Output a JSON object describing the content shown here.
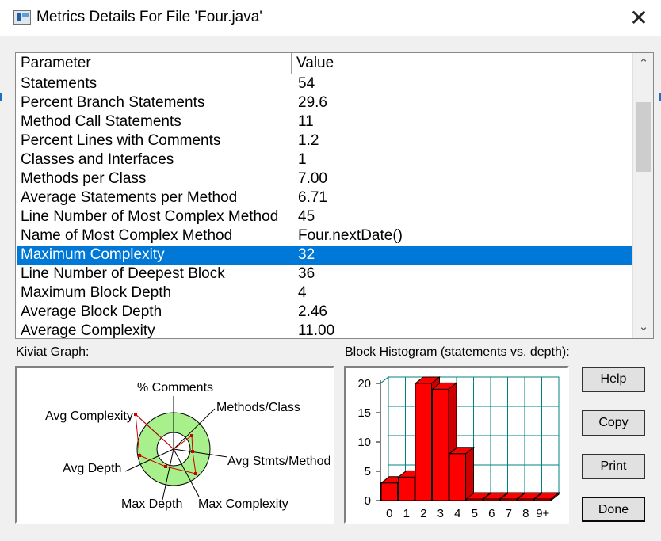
{
  "window": {
    "title": "Metrics Details For File 'Four.java'",
    "close_glyph": "✕"
  },
  "table": {
    "headers": {
      "parameter": "Parameter",
      "value": "Value"
    },
    "rows": [
      {
        "parameter": "Statements",
        "value": "54"
      },
      {
        "parameter": "Percent Branch Statements",
        "value": "29.6"
      },
      {
        "parameter": "Method Call Statements",
        "value": "11"
      },
      {
        "parameter": "Percent Lines with Comments",
        "value": "1.2"
      },
      {
        "parameter": "Classes and Interfaces",
        "value": "1"
      },
      {
        "parameter": "Methods per Class",
        "value": "7.00"
      },
      {
        "parameter": "Average Statements per Method",
        "value": "6.71"
      },
      {
        "parameter": "Line Number of Most Complex Method",
        "value": "45"
      },
      {
        "parameter": "Name of Most Complex Method",
        "value": "Four.nextDate()"
      },
      {
        "parameter": "Maximum Complexity",
        "value": "32",
        "selected": true
      },
      {
        "parameter": "Line Number of Deepest Block",
        "value": "36"
      },
      {
        "parameter": "Maximum Block Depth",
        "value": "4"
      },
      {
        "parameter": "Average Block Depth",
        "value": "2.46"
      },
      {
        "parameter": "Average Complexity",
        "value": "11.00"
      }
    ],
    "scroll_up_glyph": "⌃",
    "scroll_down_glyph": "⌄"
  },
  "kiviat": {
    "label": "Kiviat Graph:",
    "axes": [
      "% Comments",
      "Methods/Class",
      "Avg Stmts/Method",
      "Max Complexity",
      "Max Depth",
      "Avg Depth",
      "Avg Complexity"
    ],
    "ring_color": "#a8f08c",
    "polygon_color": "#cc0000"
  },
  "histogram": {
    "label": "Block Histogram (statements vs. depth):",
    "bar_color": "#ff0000",
    "grid_color": "#008080"
  },
  "chart_data": {
    "type": "bar",
    "title": "Block Histogram (statements vs. depth):",
    "categories": [
      "0",
      "1",
      "2",
      "3",
      "4",
      "5",
      "6",
      "7",
      "8",
      "9+"
    ],
    "values": [
      3,
      4,
      20,
      19,
      8,
      0,
      0,
      0,
      0,
      0
    ],
    "ylim": [
      0,
      20
    ],
    "yticks": [
      0,
      5,
      10,
      15,
      20
    ],
    "grid": true
  },
  "buttons": {
    "help": "Help",
    "copy": "Copy",
    "print": "Print",
    "done": "Done"
  }
}
